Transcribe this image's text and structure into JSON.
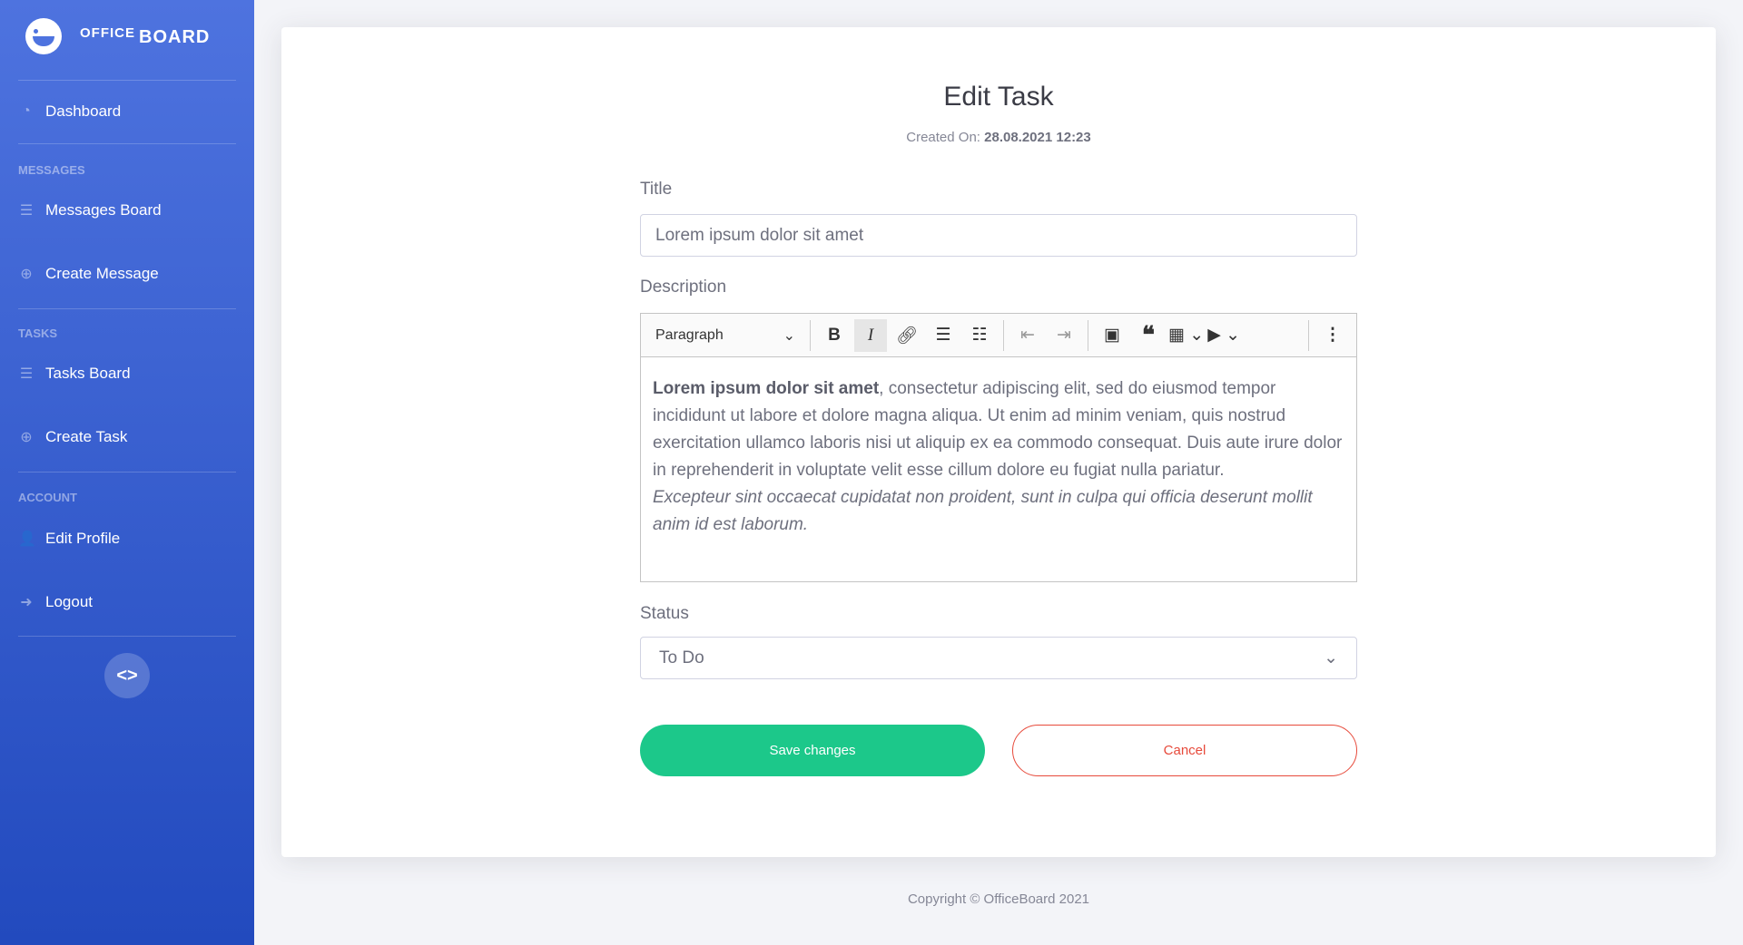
{
  "brand": {
    "word1": "OFFICE",
    "word2": "BOARD"
  },
  "sidebar": {
    "dashboard": "Dashboard",
    "sections": [
      {
        "heading": "MESSAGES",
        "items": [
          "Messages Board",
          "Create Message"
        ]
      },
      {
        "heading": "TASKS",
        "items": [
          "Tasks Board",
          "Create Task"
        ]
      },
      {
        "heading": "ACCOUNT",
        "items": [
          "Edit Profile",
          "Logout"
        ]
      }
    ],
    "toggle": "<>"
  },
  "page": {
    "title": "Edit Task",
    "created_label": "Created On:",
    "created_value": "28.08.2021 12:23"
  },
  "form": {
    "title_label": "Title",
    "title_value": "Lorem ipsum dolor sit amet",
    "description_label": "Description",
    "editor": {
      "format": "Paragraph",
      "bold_text": "Lorem ipsum dolor sit amet",
      "normal_text": ", consectetur adipiscing elit, sed do eiusmod tempor incididunt ut labore et dolore magna aliqua. Ut enim ad minim veniam, quis nostrud exercitation ullamco laboris nisi ut aliquip ex ea commodo consequat. Duis aute irure dolor in reprehenderit in voluptate velit esse cillum dolore eu fugiat nulla pariatur.",
      "italic_text": "Excepteur sint occaecat cupidatat non proident, sunt in culpa qui officia deserunt mollit anim id est laborum."
    },
    "status_label": "Status",
    "status_value": "To Do",
    "save_label": "Save changes",
    "cancel_label": "Cancel"
  },
  "footer": "Copyright © OfficeBoard 2021",
  "colors": {
    "sidebar_top": "#4e73df",
    "sidebar_bottom": "#224abe",
    "save": "#1cc88a",
    "cancel": "#e74a3b"
  }
}
